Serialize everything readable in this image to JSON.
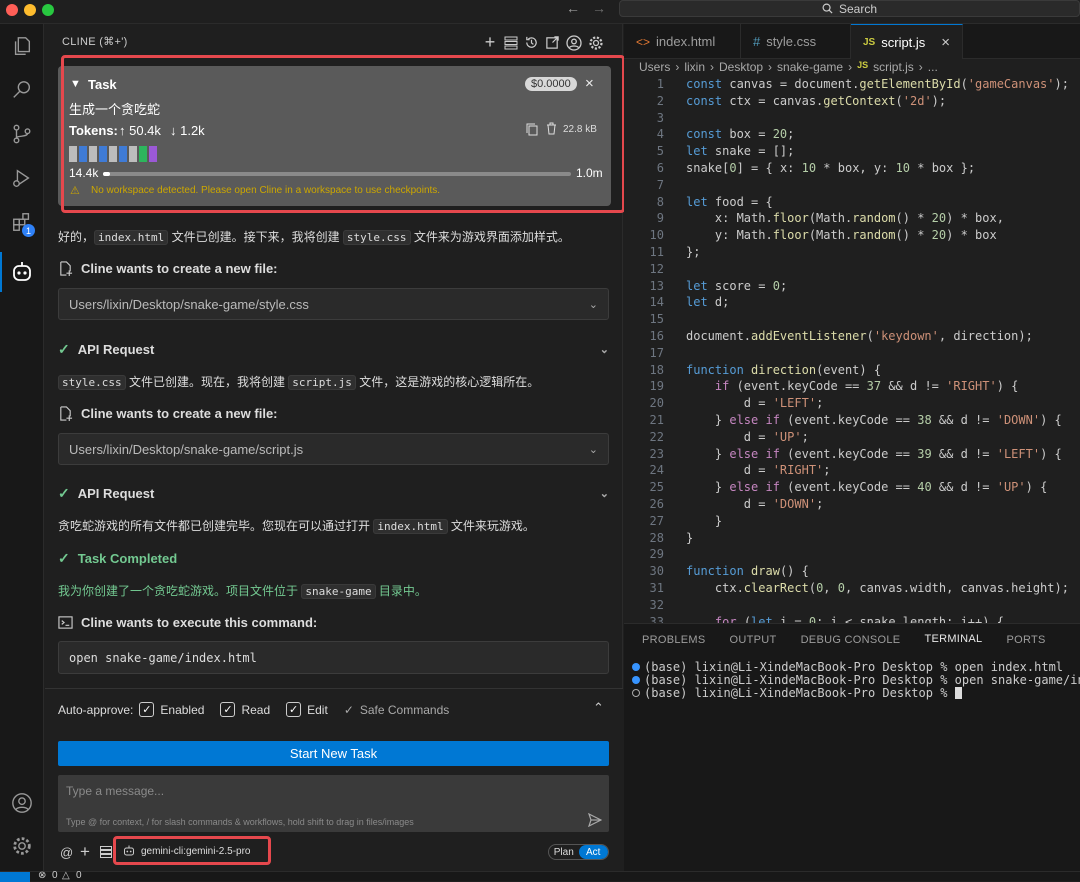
{
  "titlebar": {
    "search": "Search"
  },
  "activity": {
    "extensions_badge": "1"
  },
  "cline": {
    "title": "CLINE (⌘+')",
    "task": {
      "label": "Task",
      "cost": "$0.0000",
      "text": "生成一个贪吃蛇",
      "tokens_label": "Tokens:",
      "tokens_in": "↑ 50.4k",
      "tokens_out": "↓ 1.2k",
      "size": "22.8 kB",
      "context_used": "14.4k",
      "context_max": "1.0m",
      "context_fraction": 0.014,
      "warning": "No workspace detected. Please open Cline in a workspace to use checkpoints."
    },
    "msg1": {
      "a": "好的，",
      "code1": "index.html",
      "b": " 文件已创建。接下来，我将创建 ",
      "code2": "style.css",
      "c": " 文件来为游戏界面添加样式。"
    },
    "create1": {
      "label": "Cline wants to create a new file:",
      "path": "Users/lixin/Desktop/snake-game/style.css"
    },
    "api1": "API Request",
    "msg2": {
      "code1": "style.css",
      "a": " 文件已创建。现在，我将创建 ",
      "code2": "script.js",
      "b": " 文件，这是游戏的核心逻辑所在。"
    },
    "create2": {
      "label": "Cline wants to create a new file:",
      "path": "Users/lixin/Desktop/snake-game/script.js"
    },
    "api2": "API Request",
    "msg3": {
      "a": "贪吃蛇游戏的所有文件都已创建完毕。您现在可以通过打开 ",
      "code1": "index.html",
      "b": " 文件来玩游戏。"
    },
    "completed": "Task Completed",
    "result": {
      "a": "我为你创建了一个贪吃蛇游戏。项目文件位于 ",
      "code1": "snake-game",
      "b": " 目录中。"
    },
    "execute": {
      "label": "Cline wants to execute this command:",
      "command": "open snake-game/index.html"
    },
    "auto_approve": {
      "label": "Auto-approve:",
      "enabled": "Enabled",
      "read": "Read",
      "edit": "Edit",
      "safe": "Safe Commands"
    },
    "start_new": "Start New Task",
    "input": {
      "placeholder": "Type a message...",
      "hint": "Type @ for context, / for slash commands & workflows, hold shift to drag in files/images"
    },
    "model": "gemini-cli:gemini-2.5-pro",
    "mode": {
      "plan": "Plan",
      "act": "Act"
    }
  },
  "editor": {
    "tabs": [
      {
        "label": "index.html",
        "icon": "html-icon"
      },
      {
        "label": "style.css",
        "icon": "css-icon"
      },
      {
        "label": "script.js",
        "icon": "js-icon"
      }
    ],
    "breadcrumb": [
      "Users",
      "lixin",
      "Desktop",
      "snake-game",
      "script.js",
      "..."
    ],
    "lines": [
      "1",
      "2",
      "3",
      "4",
      "5",
      "6",
      "7",
      "8",
      "9",
      "10",
      "11",
      "12",
      "13",
      "14",
      "15",
      "16",
      "17",
      "18",
      "19",
      "20",
      "21",
      "22",
      "23",
      "24",
      "25",
      "26",
      "27",
      "28",
      "29",
      "30",
      "31",
      "32",
      "33"
    ],
    "code": [
      "const canvas = document.getElementById('gameCanvas');",
      "const ctx = canvas.getContext('2d');",
      "",
      "const box = 20;",
      "let snake = [];",
      "snake[0] = { x: 10 * box, y: 10 * box };",
      "",
      "let food = {",
      "    x: Math.floor(Math.random() * 20) * box,",
      "    y: Math.floor(Math.random() * 20) * box",
      "};",
      "",
      "let score = 0;",
      "let d;",
      "",
      "document.addEventListener('keydown', direction);",
      "",
      "function direction(event) {",
      "    if (event.keyCode == 37 && d != 'RIGHT') {",
      "        d = 'LEFT';",
      "    } else if (event.keyCode == 38 && d != 'DOWN') {",
      "        d = 'UP';",
      "    } else if (event.keyCode == 39 && d != 'LEFT') {",
      "        d = 'RIGHT';",
      "    } else if (event.keyCode == 40 && d != 'UP') {",
      "        d = 'DOWN';",
      "    }",
      "}",
      "",
      "function draw() {",
      "    ctx.clearRect(0, 0, canvas.width, canvas.height);",
      "",
      "    for (let i = 0; i < snake.length; i++) {"
    ]
  },
  "panel_tabs": [
    "PROBLEMS",
    "OUTPUT",
    "DEBUG CONSOLE",
    "TERMINAL",
    "PORTS"
  ],
  "terminal": [
    "(base) lixin@Li-XindeMacBook-Pro Desktop % open index.html",
    "(base) lixin@Li-XindeMacBook-Pro Desktop % open snake-game/index.html",
    "(base) lixin@Li-XindeMacBook-Pro Desktop % "
  ],
  "status": {
    "errors": "0",
    "warnings": "0"
  },
  "colors": {
    "accent": "#0078d4",
    "highlight": "#e5484d",
    "success": "#73c991",
    "warning": "#cca700"
  }
}
